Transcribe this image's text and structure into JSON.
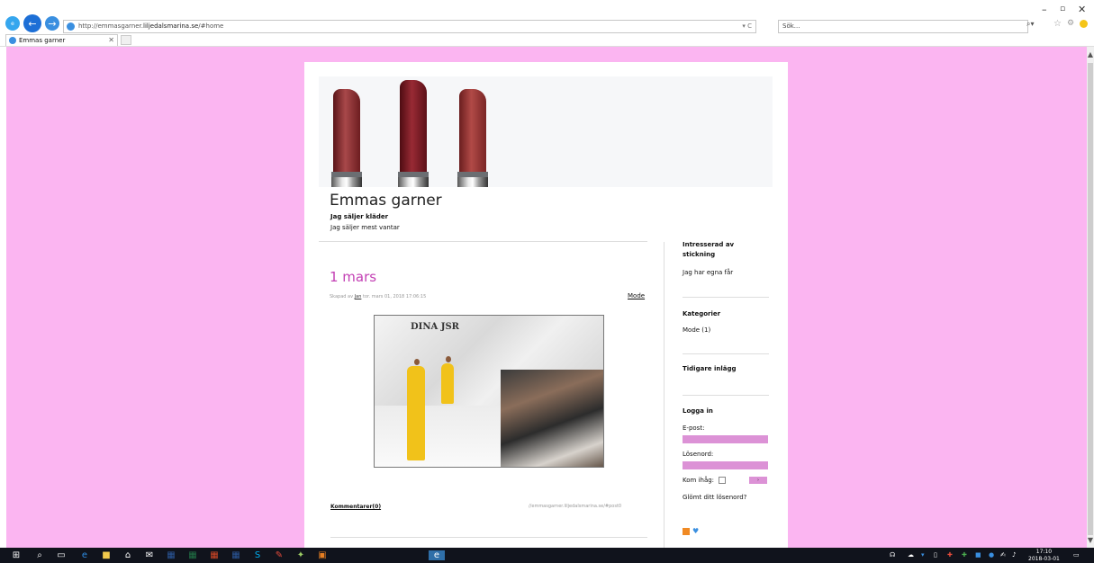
{
  "browser": {
    "url_prefix": "http://emmasgarner.",
    "url_domain": "liljedalsmarina.se",
    "url_suffix": "/#home",
    "search_placeholder": "Sök...",
    "tab_title": "Emmas garner",
    "refresh_glyph": "▾ C",
    "search_glyph": "⌕▾"
  },
  "blog": {
    "title": "Emmas garner",
    "subtitle": "Jag säljer kläder",
    "description": "Jag säljer mest vantar"
  },
  "post": {
    "title": "1 mars",
    "meta_prefix": "Skapad av ",
    "author": "Jan",
    "meta_date": " tor. mars 01, 2018 17:06:15",
    "category": "Mode",
    "image_text": "DINA JSR",
    "comments": "Kommentarer(0)",
    "permalink": "//emmasgarner.liljedalsmarina.se/#post0"
  },
  "sidebar": {
    "about_heading": "Intresserad av stickning",
    "about_text": "Jag har egna får",
    "categories_heading": "Kategorier",
    "category_item": "Mode (1)",
    "archive_heading": "Tidigare inlägg",
    "login_heading": "Logga in",
    "email_label": "E-post:",
    "password_label": "Lösenord:",
    "remember_label": "Kom ihåg:",
    "go_label": "›",
    "forgot": "Glömt ditt lösenord?"
  },
  "taskbar": {
    "time": "17:10",
    "date": "2018-03-01"
  },
  "colors": {
    "page_background": "#fbb5f1",
    "accent": "#c340b4",
    "field": "#dc92d6"
  }
}
